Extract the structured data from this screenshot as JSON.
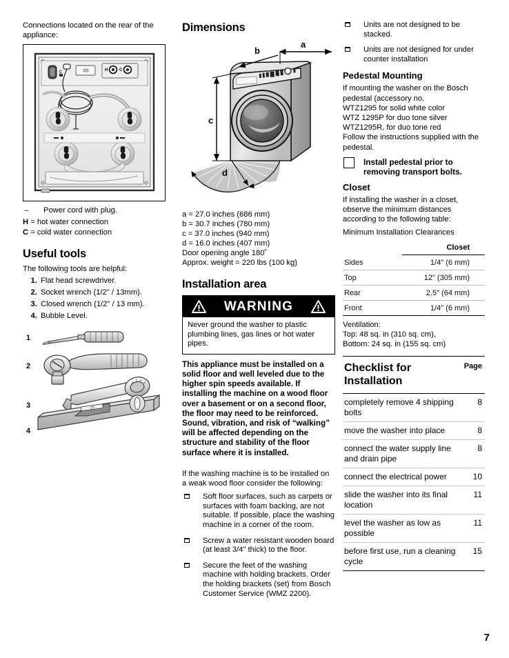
{
  "page_number": "7",
  "left_column": {
    "intro_text": "Connections located on the rear of the appliance:",
    "figure_name": "washer-rear-connections-diagram",
    "legend": [
      {
        "marker": "–",
        "text": "Power cord with plug."
      },
      {
        "marker": "H",
        "text": "= hot water connection"
      },
      {
        "marker": "C",
        "text": "= cold water connection"
      }
    ],
    "useful_tools_heading": "Useful tools",
    "useful_tools_intro": "The following tools are helpful:",
    "tools": [
      "Flat head screwdriver.",
      "Socket wrench (1/2\" / 13mm).",
      "Closed wrench (1/2\" / 13 mm).",
      "Bubble Level."
    ],
    "tool_figure_labels": [
      "1",
      "2",
      "3",
      "4"
    ]
  },
  "middle_column": {
    "dimensions_heading": "Dimensions",
    "diagram_labels": {
      "a": "a",
      "b": "b",
      "c": "c",
      "d": "d"
    },
    "dimension_lines": [
      "a = 27.0 inches (686 mm)",
      "b = 30.7 inches (780 mm)",
      "c = 37.0 inches (940 mm)",
      "d = 16.0 inches (407 mm)",
      "Door opening angle 180˚",
      "Approx. weight = 220 lbs (100 kg)"
    ],
    "installation_area_heading": "Installation area",
    "warning": {
      "title": "WARNING",
      "body": "Never ground the washer to plastic plumbing lines, gas lines or hot water pipes."
    },
    "bold_paragraph": "This appliance must be installed on a solid floor and well leveled due to the higher spin speeds available. If installing the machine on a wood floor over a basement or on a second floor, the floor may need to be reinforced. Sound, vibration, and risk of “walking” will be affected depending on the structure and stability of the floor surface where it is installed.",
    "weak_floor_intro": "If the washing machine is to be installed on a weak wood floor consider the following:",
    "weak_floor_items": [
      "Soft floor surfaces, such as carpets or surfaces with foam backing, are not suitable. If possible, place the washing machine in a corner of the room.",
      "Screw a water resistant wooden board (at least 3/4\" thick) to the floor.",
      "Secure the feet of the washing machine with holding brackets. Order the holding brackets (set) from Bosch Customer Service (WMZ 2200)."
    ]
  },
  "right_column": {
    "top_items": [
      "Units are not designed to be stacked.",
      "Units are not designed for under counter installation"
    ],
    "pedestal_heading": "Pedestal Mounting",
    "pedestal_intro": "If mounting the washer on the Bosch pedestal (accessory no.",
    "pedestal_models": [
      "WTZ1295 for solid white color",
      "WTZ 1295P  for duo tone silver",
      "WTZ1295R, for duo tone red"
    ],
    "pedestal_follow": "Follow the instructions supplied with the pedestal.",
    "pedestal_note": "Install pedestal prior to removing transport bolts.",
    "closet_heading": "Closet",
    "closet_intro": "If installing the washer in a closet, observe the minimum distances according to the following table:",
    "clearance_table": {
      "caption": "Minimum Installation Clearances",
      "columns": [
        "",
        "Closet"
      ],
      "rows": [
        {
          "label": "Sides",
          "value": "1/4\" (6 mm)"
        },
        {
          "label": "Top",
          "value": "12\" (305 mm)"
        },
        {
          "label": "Rear",
          "value": "2.5\" (64 mm)"
        },
        {
          "label": "Front",
          "value": "1/4\" (6 mm)"
        }
      ]
    },
    "ventilation": [
      "Ventilation:",
      "Top: 48 sq. in (310 sq. cm),",
      "Bottom: 24 sq. in (155 sq. cm)"
    ],
    "checklist": {
      "title": "Checklist for Installation",
      "page_header": "Page",
      "rows": [
        {
          "item": "completely remove 4 shipping bolts",
          "page": "8"
        },
        {
          "item": "move the washer into place",
          "page": "8"
        },
        {
          "item": "connect the water supply line and drain pipe",
          "page": "8"
        },
        {
          "item": "connect the electrical power",
          "page": "10"
        },
        {
          "item": "slide the washer into its final location",
          "page": "11"
        },
        {
          "item": "level the washer as low as possible",
          "page": "11"
        },
        {
          "item": "before first use, run a cleaning cycle",
          "page": "15"
        }
      ]
    }
  }
}
